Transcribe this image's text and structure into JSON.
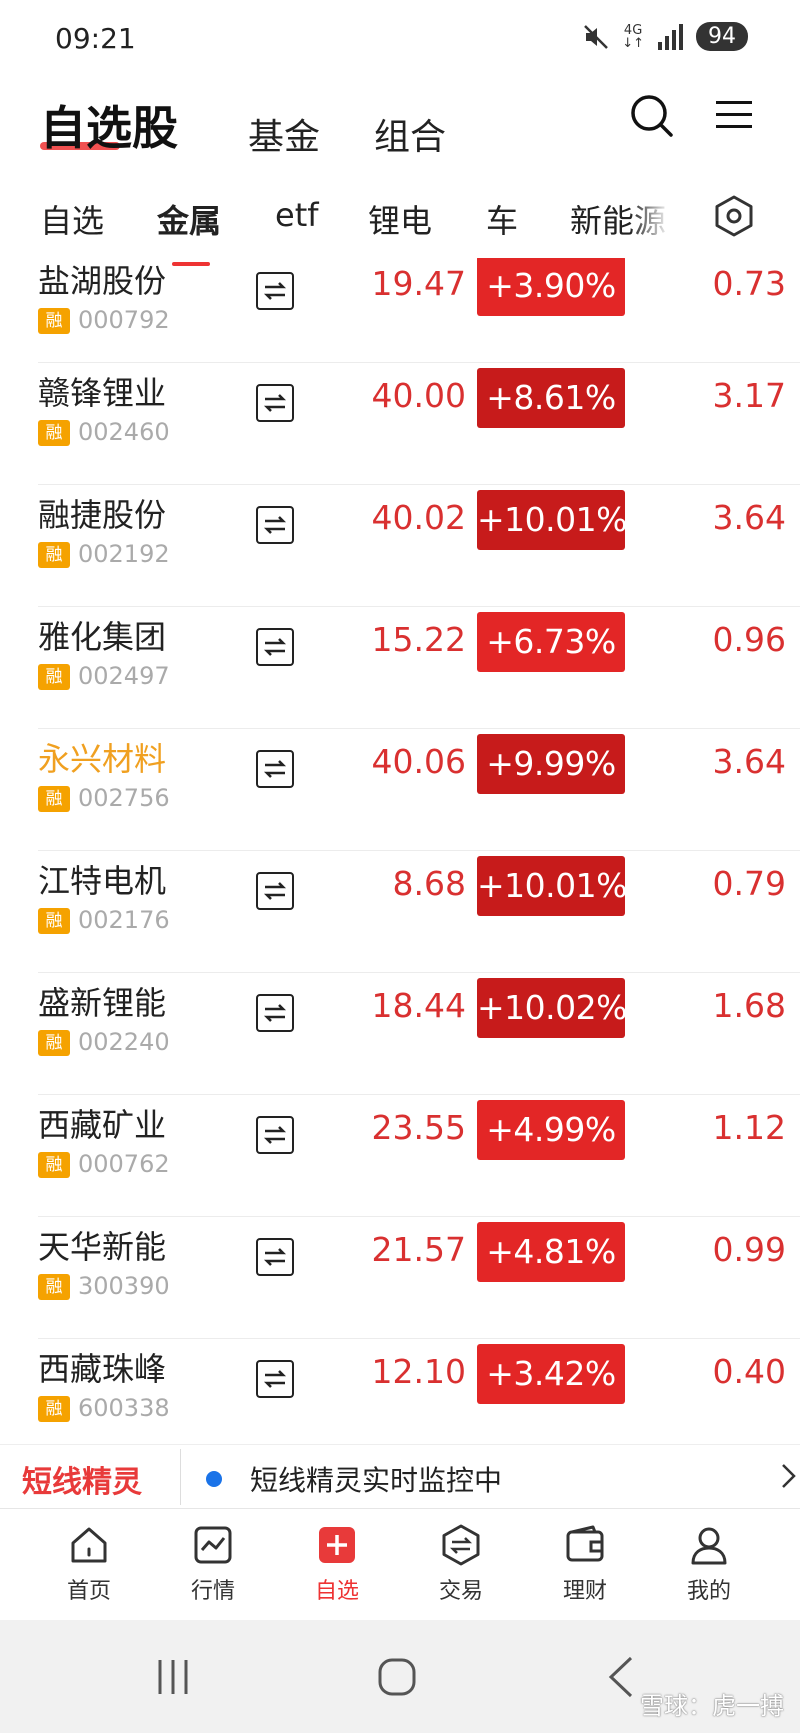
{
  "status_bar": {
    "time": "09:21",
    "net_top": "4G",
    "net_bottom": "↓↑",
    "battery": "94"
  },
  "header": {
    "title": "自选股",
    "tabs": [
      {
        "label": "基金"
      },
      {
        "label": "组合"
      }
    ]
  },
  "categories": [
    {
      "label": "自选",
      "active": false
    },
    {
      "label": "金属",
      "active": true
    },
    {
      "label": "etf",
      "active": false
    },
    {
      "label": "锂电",
      "active": false
    },
    {
      "label": "车",
      "active": false
    },
    {
      "label": "新能源",
      "active": false
    }
  ],
  "stocks": [
    {
      "name": "盐湖股份",
      "badge": "融",
      "code": "000792",
      "price": "19.47",
      "change": "+3.90%",
      "ratio": "0.73",
      "highlight": false
    },
    {
      "name": "赣锋锂业",
      "badge": "融",
      "code": "002460",
      "price": "40.00",
      "change": "+8.61%",
      "ratio": "3.17",
      "highlight": false
    },
    {
      "name": "融捷股份",
      "badge": "融",
      "code": "002192",
      "price": "40.02",
      "change": "+10.01%",
      "ratio": "3.64",
      "highlight": false
    },
    {
      "name": "雅化集团",
      "badge": "融",
      "code": "002497",
      "price": "15.22",
      "change": "+6.73%",
      "ratio": "0.96",
      "highlight": false
    },
    {
      "name": "永兴材料",
      "badge": "融",
      "code": "002756",
      "price": "40.06",
      "change": "+9.99%",
      "ratio": "3.64",
      "highlight": true
    },
    {
      "name": "江特电机",
      "badge": "融",
      "code": "002176",
      "price": "8.68",
      "change": "+10.01%",
      "ratio": "0.79",
      "highlight": false
    },
    {
      "name": "盛新锂能",
      "badge": "融",
      "code": "002240",
      "price": "18.44",
      "change": "+10.02%",
      "ratio": "1.68",
      "highlight": false
    },
    {
      "name": "西藏矿业",
      "badge": "融",
      "code": "000762",
      "price": "23.55",
      "change": "+4.99%",
      "ratio": "1.12",
      "highlight": false
    },
    {
      "name": "天华新能",
      "badge": "融",
      "code": "300390",
      "price": "21.57",
      "change": "+4.81%",
      "ratio": "0.99",
      "highlight": false
    },
    {
      "name": "西藏珠峰",
      "badge": "融",
      "code": "600338",
      "price": "12.10",
      "change": "+3.42%",
      "ratio": "0.40",
      "highlight": false
    }
  ],
  "ticker": {
    "brand": "短线精灵",
    "message": "短线精灵实时监控中"
  },
  "bottom_nav": [
    {
      "label": "首页",
      "icon": "home-icon"
    },
    {
      "label": "行情",
      "icon": "chart-icon"
    },
    {
      "label": "自选",
      "icon": "plus-icon",
      "active": true
    },
    {
      "label": "交易",
      "icon": "exchange-icon"
    },
    {
      "label": "理财",
      "icon": "wallet-icon"
    },
    {
      "label": "我的",
      "icon": "user-icon"
    }
  ],
  "watermark": "雪球：虎一搏",
  "colors": {
    "up_red": "#d93030",
    "badge_bg": "#e32626",
    "badge_deep": "#c71b1b",
    "margin_badge": "#f5a200",
    "accent": "#e33333",
    "highlight_name": "#f0a020"
  }
}
